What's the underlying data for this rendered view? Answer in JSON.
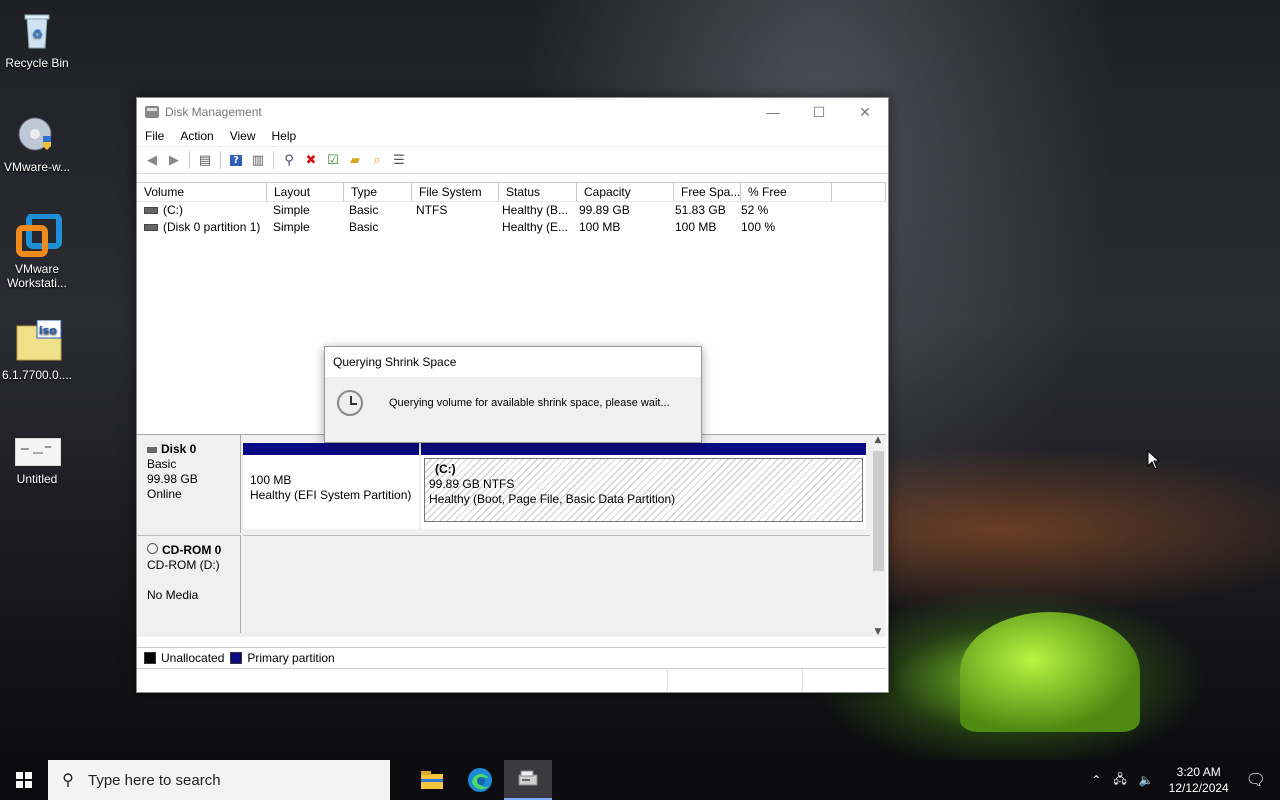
{
  "desktop": {
    "icons": [
      {
        "label": "Recycle Bin"
      },
      {
        "label": "VMware-w..."
      },
      {
        "label": "VMware Workstati..."
      },
      {
        "label": "6.1.7700.0...."
      },
      {
        "label": "Untitled"
      }
    ]
  },
  "window": {
    "title": "Disk Management",
    "menu": [
      "File",
      "Action",
      "View",
      "Help"
    ],
    "columns": [
      "Volume",
      "Layout",
      "Type",
      "File System",
      "Status",
      "Capacity",
      "Free Spa...",
      "% Free"
    ],
    "volumes": [
      {
        "volume": "(C:)",
        "layout": "Simple",
        "type": "Basic",
        "fs": "NTFS",
        "status": "Healthy (B...",
        "capacity": "99.89 GB",
        "free": "51.83 GB",
        "pct": "52 %"
      },
      {
        "volume": "(Disk 0 partition 1)",
        "layout": "Simple",
        "type": "Basic",
        "fs": "",
        "status": "Healthy (E...",
        "capacity": "100 MB",
        "free": "100 MB",
        "pct": "100 %"
      }
    ],
    "disk0": {
      "name": "Disk 0",
      "type": "Basic",
      "size": "99.98 GB",
      "state": "Online",
      "p1": {
        "size": "100 MB",
        "status": "Healthy (EFI System Partition)"
      },
      "p2": {
        "name": "(C:)",
        "size": "99.89 GB NTFS",
        "status": "Healthy (Boot, Page File, Basic Data Partition)"
      }
    },
    "cdrom": {
      "name": "CD-ROM 0",
      "drive": "CD-ROM (D:)",
      "media": "No Media"
    },
    "legend": {
      "unallocated": "Unallocated",
      "primary": "Primary partition"
    }
  },
  "dialog": {
    "title": "Querying Shrink Space",
    "message": "Querying volume for available shrink space, please wait..."
  },
  "taskbar": {
    "search_placeholder": "Type here to search",
    "time": "3:20 AM",
    "date": "12/12/2024"
  },
  "colors": {
    "primary_partition": "#0a0a84",
    "unallocated": "#000000"
  }
}
